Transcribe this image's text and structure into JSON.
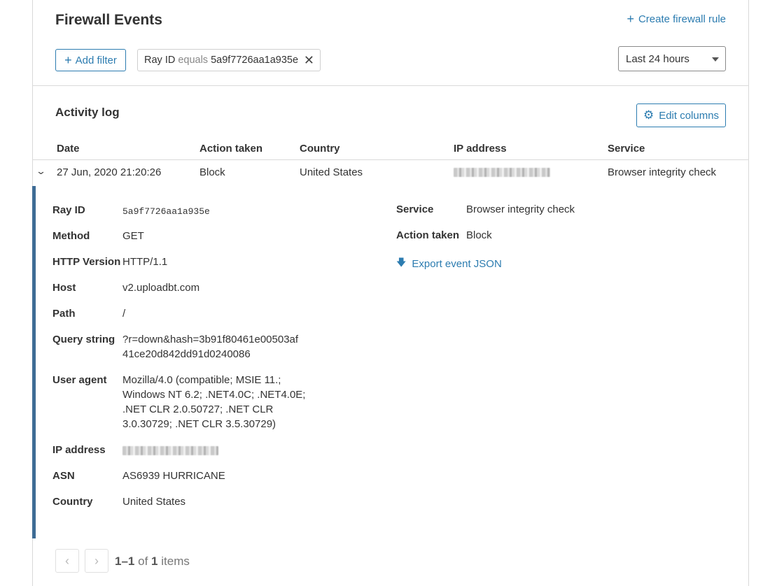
{
  "header": {
    "title": "Firewall Events",
    "create_rule_label": "Create firewall rule"
  },
  "filters": {
    "add_filter_label": "Add filter",
    "chip": {
      "field": "Ray ID",
      "operator": "equals",
      "value": "5a9f7726aa1a935e"
    }
  },
  "time_range": {
    "selected": "Last 24 hours"
  },
  "activity": {
    "title": "Activity log",
    "edit_columns_label": "Edit columns",
    "columns": [
      "Date",
      "Action taken",
      "Country",
      "IP address",
      "Service"
    ],
    "row": {
      "date": "27 Jun, 2020 21:20:26",
      "action": "Block",
      "country": "United States",
      "service": "Browser integrity check"
    }
  },
  "details": {
    "ray_id_label": "Ray ID",
    "ray_id": "5a9f7726aa1a935e",
    "method_label": "Method",
    "method": "GET",
    "http_version_label": "HTTP Version",
    "http_version": "HTTP/1.1",
    "host_label": "Host",
    "host": "v2.uploadbt.com",
    "path_label": "Path",
    "path": "/",
    "query_label": "Query string",
    "query_line1": "?r=down&hash=3b91f80461e00503af",
    "query_line2": "41ce20d842dd91d0240086",
    "ua_label": "User agent",
    "ua_line1": "Mozilla/4.0 (compatible; MSIE 11.;",
    "ua_line2": "Windows NT 6.2; .NET4.0C; .NET4.0E;",
    "ua_line3": ".NET CLR 2.0.50727; .NET CLR",
    "ua_line4": "3.0.30729; .NET CLR 3.5.30729)",
    "ip_label": "IP address",
    "asn_label": "ASN",
    "asn": "AS6939 HURRICANE",
    "country_label": "Country",
    "country": "United States",
    "service_label": "Service",
    "service": "Browser integrity check",
    "action_label": "Action taken",
    "action": "Block",
    "export_label": "Export event JSON"
  },
  "pagination": {
    "range": "1–1",
    "of": "of",
    "total": "1",
    "items": "items"
  }
}
